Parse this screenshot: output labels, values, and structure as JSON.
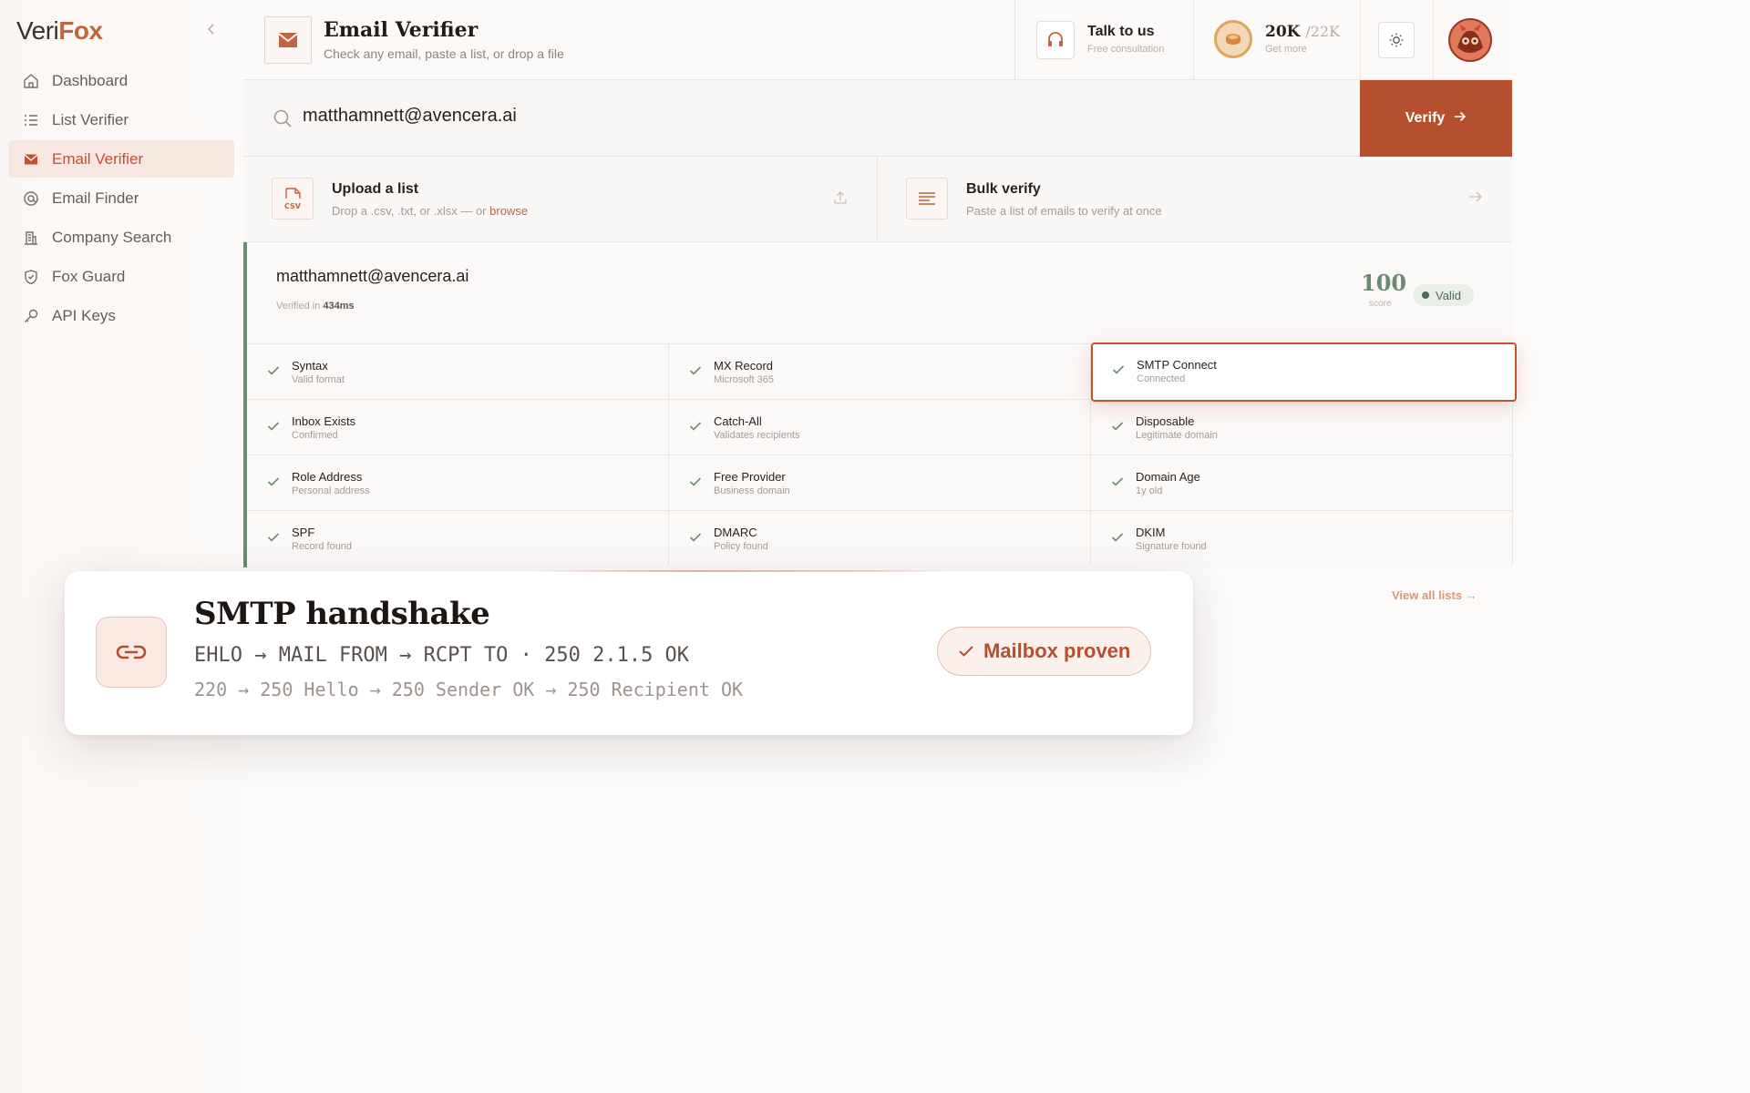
{
  "app": {
    "logo_text_a": "Veri",
    "logo_text_b": "Fox",
    "accent": "#b5502e",
    "valid_color": "#4f6a57"
  },
  "sidebar": {
    "items": [
      {
        "label": "Dashboard",
        "icon": "home-icon"
      },
      {
        "label": "List Verifier",
        "icon": "list-icon"
      },
      {
        "label": "Email Verifier",
        "icon": "envelope-icon",
        "active": true
      },
      {
        "label": "Email Finder",
        "icon": "at-icon"
      },
      {
        "label": "Company Search",
        "icon": "building-icon"
      },
      {
        "label": "Fox Guard",
        "icon": "shield-icon"
      },
      {
        "label": "API Keys",
        "icon": "key-icon"
      }
    ]
  },
  "header": {
    "title": "Email Verifier",
    "subtitle": "Check any email, paste a list, or drop a file",
    "talk_title": "Talk to us",
    "talk_sub": "Free consultation",
    "credits_value": "20K",
    "credits_total": "/22K",
    "credits_sub": "Get more"
  },
  "search": {
    "value": "matthamnett@avencera.ai",
    "button_label": "Verify"
  },
  "cards": {
    "upload_title": "Upload a list",
    "upload_sub": "Drop a .csv, .txt, or .xlsx — or",
    "upload_link": "browse",
    "upload_icon_text": "CSV",
    "bulk_title": "Bulk verify",
    "bulk_sub": "Paste a list of emails to verify at once"
  },
  "result": {
    "email": "matthamnett@avencera.ai",
    "verified_prefix": "Verified in",
    "verified_time": "434ms",
    "score": "100",
    "score_label": "score",
    "status": "Valid",
    "checks": [
      {
        "name": "Syntax",
        "detail": "Valid format"
      },
      {
        "name": "MX Record",
        "detail": "Microsoft 365"
      },
      {
        "name": "SMTP Connect",
        "detail": "Connected",
        "highlight": true
      },
      {
        "name": "Inbox Exists",
        "detail": "Confirmed"
      },
      {
        "name": "Catch-All",
        "detail": "Validates recipients"
      },
      {
        "name": "Disposable",
        "detail": "Legitimate domain"
      },
      {
        "name": "Role Address",
        "detail": "Personal address"
      },
      {
        "name": "Free Provider",
        "detail": "Business domain"
      },
      {
        "name": "Domain Age",
        "detail": "1y old"
      },
      {
        "name": "SPF",
        "detail": "Record found"
      },
      {
        "name": "DMARC",
        "detail": "Policy found"
      },
      {
        "name": "DKIM",
        "detail": "Signature found"
      }
    ],
    "view_all": "View all lists"
  },
  "popup": {
    "title": "SMTP handshake",
    "line1": "EHLO → MAIL FROM → RCPT TO · 250 2.1.5 OK",
    "line2": "220 → 250 Hello → 250 Sender OK → 250 Recipient OK",
    "badge": "Mailbox proven",
    "icon": "link-icon"
  }
}
